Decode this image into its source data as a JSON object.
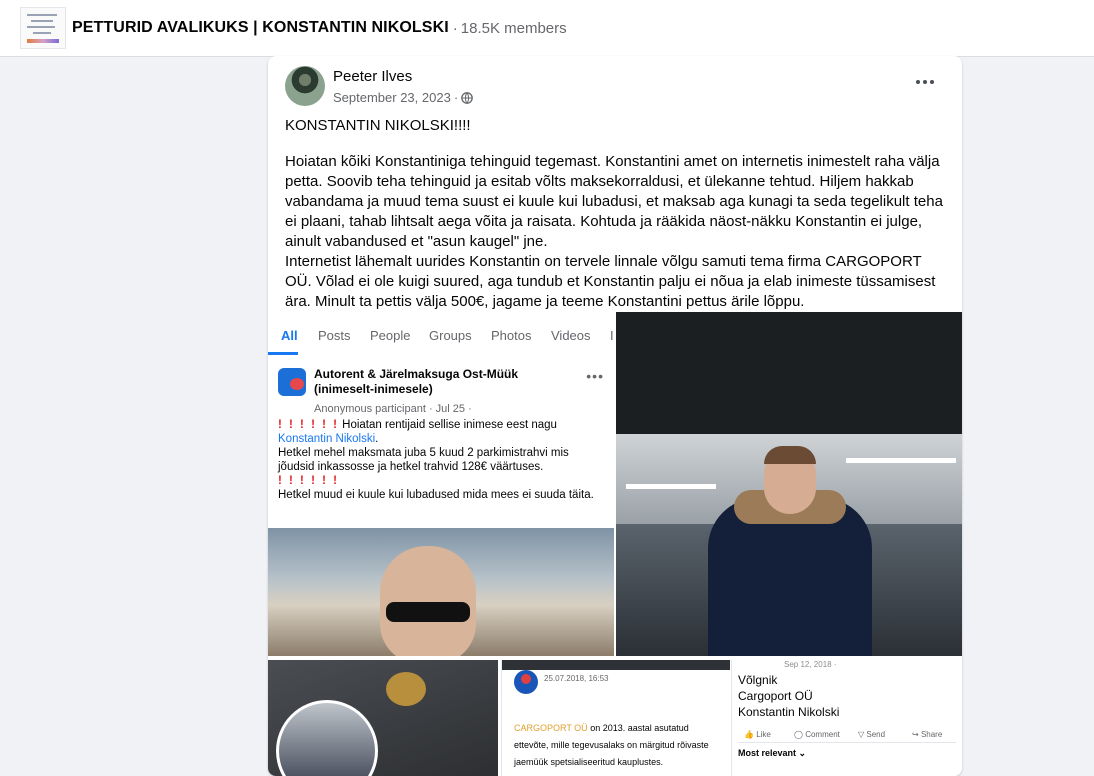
{
  "group": {
    "name": "PETTURID AVALIKUKS | KONSTANTIN NIKOLSKI",
    "separator": "·",
    "members": "18.5K members"
  },
  "post": {
    "author": "Peeter Ilves",
    "date": "September 23, 2023",
    "date_separator": "·",
    "privacy_icon": "globe-icon",
    "more_icon": "more-dots-icon",
    "title": "KONSTANTIN NIKOLSKI!!!!",
    "body": "Hoiatan kõiki Konstantiniga tehinguid tegemast. Konstantini amet on internetis inimestelt raha välja petta. Soovib teha tehinguid ja esitab võlts maksekorraldusi, et ülekanne tehtud. Hiljem hakkab vabandama ja muud tema suust ei kuule kui lubadusi, et maksab aga kunagi ta seda tegelikult teha ei plaani, tahab lihtsalt aega võita ja raisata. Kohtuda ja rääkida näost-näkku Konstantin ei julge, ainult vabandused et \"asun kaugel\" jne.",
    "body2": "Internetist lähemalt uurides Konstantin on tervele linnale võlgu samuti tema firma CARGOPORT OÜ. Võlad ei ole kuigi suured, aga tundub et Konstantin palju ei nõua ja elab inimeste tüssamisest ära. Minult ta pettis välja 500€, jagame ja teeme Konstantini pettus ärile lõppu."
  },
  "photo1": {
    "tabs": [
      "All",
      "Posts",
      "People",
      "Groups",
      "Photos",
      "Videos",
      "I"
    ],
    "card_name": "Autorent & Järelmaksuga Ost-Müük (inimeselt-inimesele)",
    "card_more": "•••",
    "card_sub": "Anonymous participant · Jul 25 ·",
    "exclaims": "! ! ! ! ! !",
    "line1": "Hoiatan rentijaid sellise inimese eest nagu",
    "link": "Konstantin Nikolski",
    "line1_end": ".",
    "line2": "Hetkel mehel maksmata juba 5 kuud 2 parkimistrahvi mis jõudsid inkassosse ja hetkel trahvid  128€ väärtuses.",
    "line3": "Hetkel muud ei kuule kui lubadused mida mees ei suuda täita."
  },
  "photo4": {
    "date": "25.07.2018, 16:53",
    "company": "CARGOPORT OÜ",
    "text": "on 2013. aastal asutatud ettevõte, mille tegevusalaks on märgitud rõivaste jaemüük spetsialiseeritud kauplustes."
  },
  "photo5": {
    "faint": "Sep 12, 2018 ·",
    "lines": [
      "Võlgnik",
      "Cargoport OÜ",
      "Konstantin Nikolski"
    ],
    "actions": [
      "Like",
      "Comment",
      "Send",
      "Share"
    ],
    "sort": "Most relevant ⌄"
  }
}
